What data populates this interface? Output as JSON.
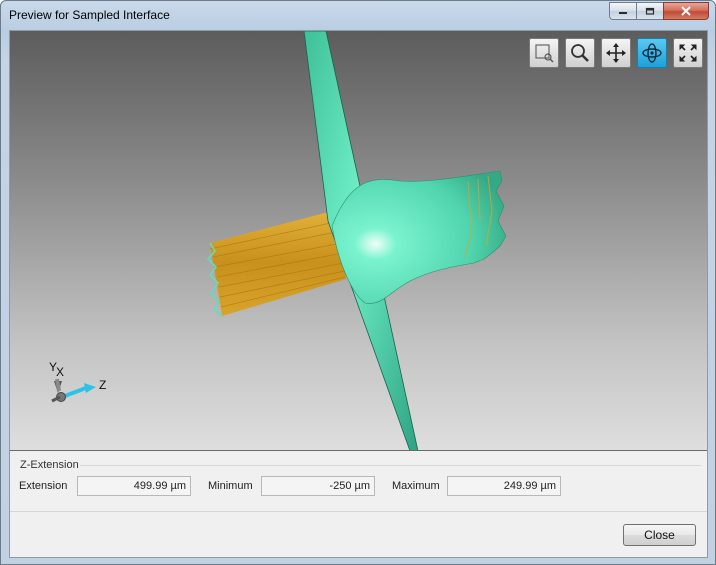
{
  "window": {
    "title": "Preview for Sampled Interface",
    "minimize_label": "minimize",
    "maximize_label": "maximize",
    "close_label": "close"
  },
  "toolbar": {
    "buttons": [
      {
        "name": "zoom-box-icon",
        "active": false
      },
      {
        "name": "magnify-icon",
        "active": false
      },
      {
        "name": "pan-icon",
        "active": false
      },
      {
        "name": "rotate-icon",
        "active": true
      },
      {
        "name": "fit-all-icon",
        "active": false
      }
    ]
  },
  "axes": {
    "y": "Y",
    "x": "X",
    "z": "Z"
  },
  "z_extension": {
    "legend": "Z-Extension",
    "extension_label": "Extension",
    "extension_value": "499.99 µm",
    "minimum_label": "Minimum",
    "minimum_value": "-250 µm",
    "maximum_label": "Maximum",
    "maximum_value": "249.99 µm"
  },
  "footer": {
    "close_label": "Close"
  },
  "colors": {
    "surface_teal": "#5fe0b8",
    "surface_orange": "#d9a22a",
    "accent_blue": "#1da1d8"
  }
}
